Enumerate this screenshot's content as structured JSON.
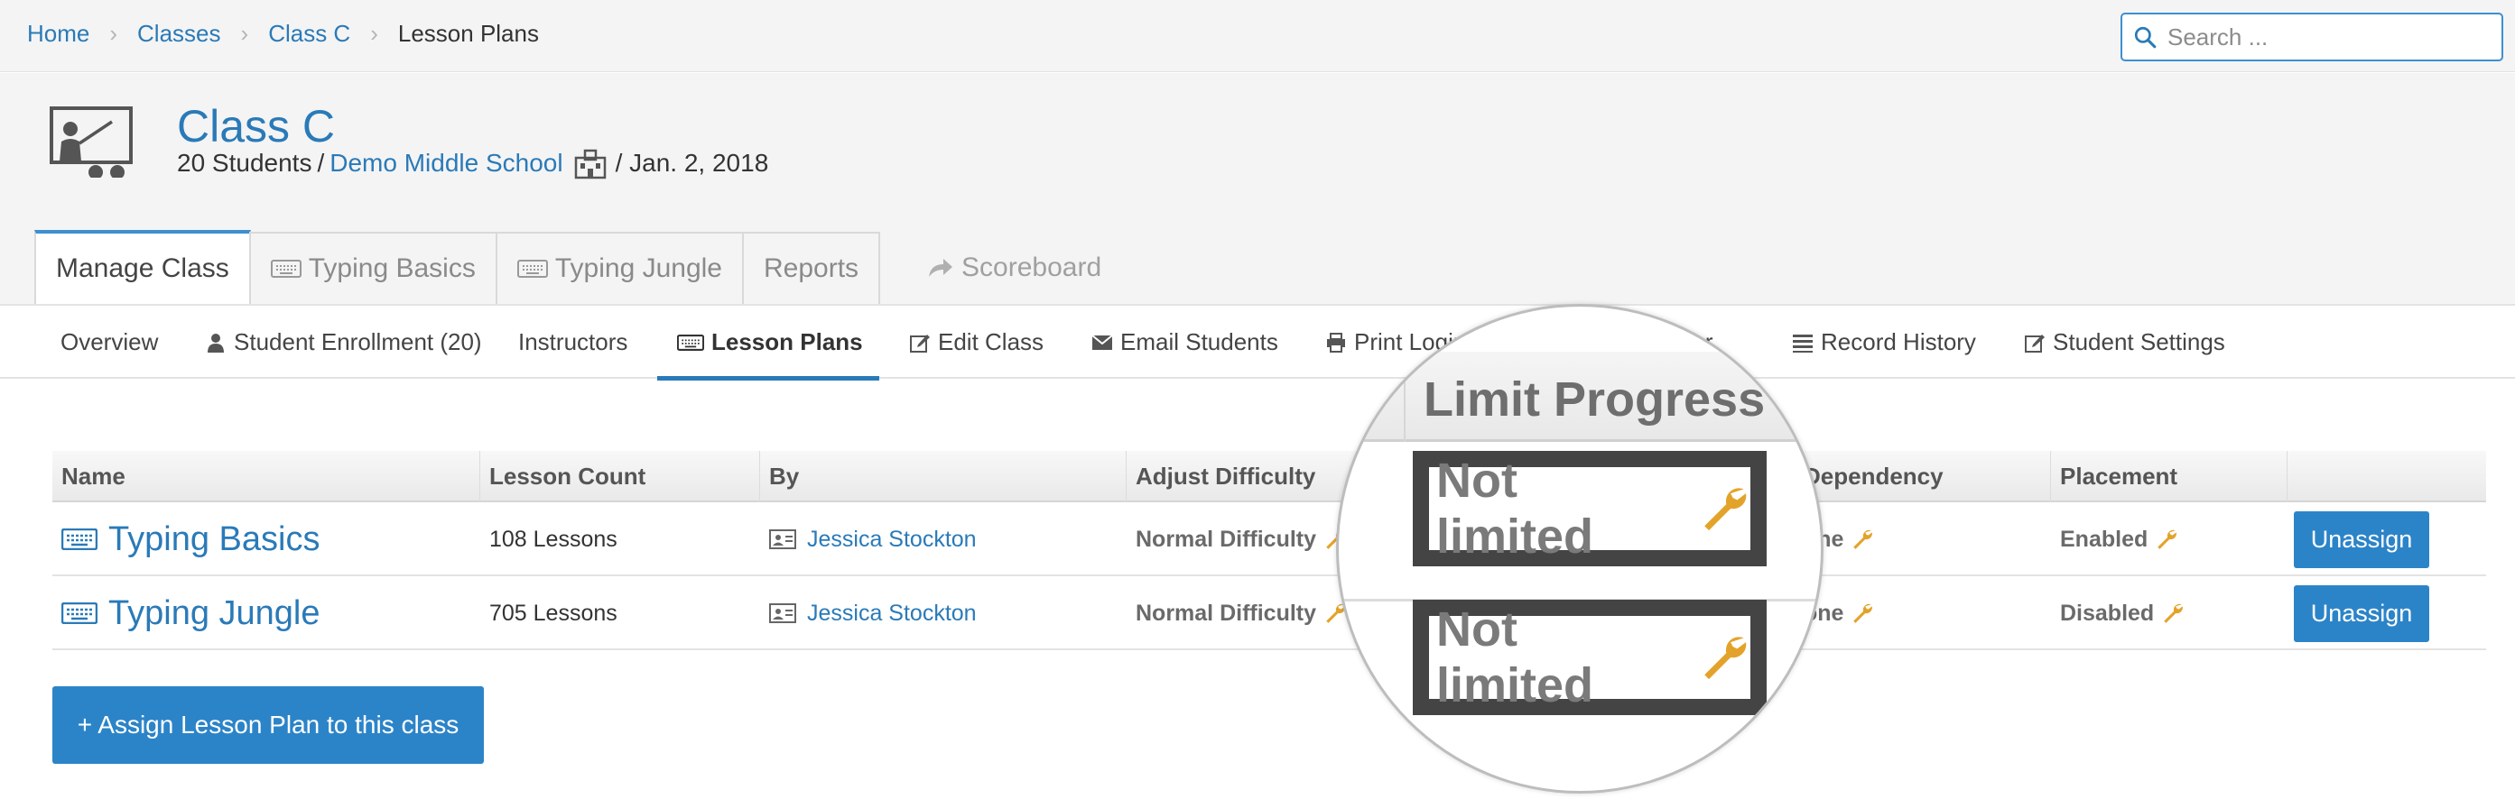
{
  "breadcrumb": {
    "items": [
      "Home",
      "Classes",
      "Class C"
    ],
    "current": "Lesson Plans"
  },
  "search": {
    "placeholder": "Search ..."
  },
  "class_info": {
    "title": "Class C",
    "students": "20 Students",
    "slash": "/",
    "school": "Demo Middle School",
    "date": "/ Jan. 2, 2018"
  },
  "tabs": {
    "manage": "Manage Class",
    "typing_basics": "Typing Basics",
    "typing_jungle": "Typing Jungle",
    "reports": "Reports",
    "scoreboard": "Scoreboard"
  },
  "subnav": {
    "overview": "Overview",
    "enrollment": "Student Enrollment (20)",
    "instructors": "Instructors",
    "lesson_plans": "Lesson Plans",
    "edit_class": "Edit Class",
    "email_students": "Email Students",
    "print_logins": "Print Login",
    "letter": "tter",
    "record_history": "Record History",
    "student_settings": "Student Settings"
  },
  "table": {
    "headers": {
      "name": "Name",
      "lesson_count": "Lesson Count",
      "by": "By",
      "adjust_difficulty": "Adjust Difficulty",
      "dependency": "Dependency",
      "placement": "Placement"
    },
    "rows": [
      {
        "name": "Typing Basics",
        "lesson_count": "108 Lessons",
        "author": "Jessica Stockton",
        "difficulty": "Normal Difficulty",
        "dependency": "one",
        "placement": "Enabled",
        "action": "Unassign"
      },
      {
        "name": "Typing Jungle",
        "lesson_count": "705 Lessons",
        "author": "Jessica Stockton",
        "difficulty": "Normal Difficulty",
        "dependency": "one",
        "placement": "Disabled",
        "action": "Unassign"
      }
    ]
  },
  "assign_button": "+ Assign Lesson Plan to this class",
  "magnifier": {
    "header": "Limit Progress",
    "rows": [
      "Not limited",
      "Not limited"
    ]
  },
  "colors": {
    "link_blue": "#2a7ab8",
    "button_blue": "#2c84c8",
    "wrench_orange": "#e3a32a"
  }
}
